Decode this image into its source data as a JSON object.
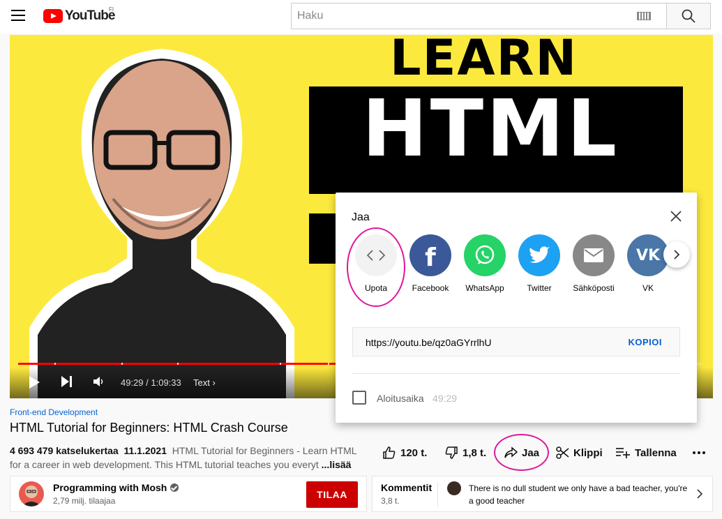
{
  "header": {
    "logo_text": "YouTube",
    "country_code": "FI",
    "search_placeholder": "Haku"
  },
  "player": {
    "thumbnail_text_top": "LEARN",
    "thumbnail_text_main": "HTML",
    "time_display": "49:29 / 1:09:33",
    "chapter_label": "Text",
    "progress_fraction": 0.713
  },
  "share_dialog": {
    "title": "Jaa",
    "targets": [
      {
        "label": "Upota",
        "icon": "embed-icon",
        "color": "#f2f2f2"
      },
      {
        "label": "Facebook",
        "icon": "facebook-icon",
        "color": "#3b5998"
      },
      {
        "label": "WhatsApp",
        "icon": "whatsapp-icon",
        "color": "#25d366"
      },
      {
        "label": "Twitter",
        "icon": "twitter-icon",
        "color": "#1da1f2"
      },
      {
        "label": "Sähköposti",
        "icon": "email-icon",
        "color": "#888888"
      },
      {
        "label": "VK",
        "icon": "vk-icon",
        "color": "#4a76a8"
      }
    ],
    "url": "https://youtu.be/qz0aGYrrlhU",
    "copy_label": "KOPIOI",
    "start_label": "Aloitusaika",
    "start_time": "49:29"
  },
  "video": {
    "category": "Front-end Development",
    "title": "HTML Tutorial for Beginners: HTML Crash Course",
    "views": "4 693 479 katselukertaa",
    "date": "11.1.2021",
    "description": "HTML Tutorial for Beginners - Learn HTML for a career in web development. This HTML tutorial teaches you everyt",
    "more_label": "...lisää"
  },
  "actions": {
    "likes": "120 t.",
    "dislikes": "1,8 t.",
    "share": "Jaa",
    "clip": "Klippi",
    "save": "Tallenna"
  },
  "channel": {
    "name": "Programming with Mosh",
    "subscribers": "2,79 milj. tilaajaa",
    "subscribe_label": "TILAA"
  },
  "comments": {
    "label": "Kommentit",
    "count": "3,8 t.",
    "top_comment": "There is no dull student we only have a bad teacher, you're a good teacher"
  },
  "colors": {
    "brand_red": "#ff0000",
    "subscribe_red": "#cc0000",
    "link_blue": "#065fd4",
    "highlight_pink": "#e0169c",
    "thumbnail_yellow": "#fce93e"
  }
}
